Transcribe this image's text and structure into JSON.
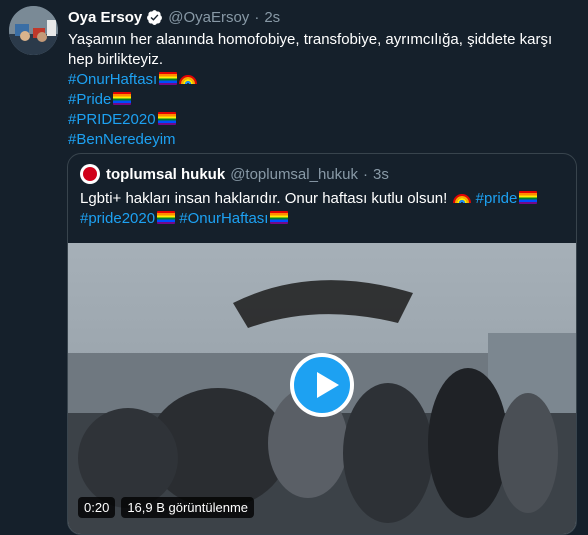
{
  "tweet": {
    "name": "Oya Ersoy",
    "handle": "@OyaErsoy",
    "separator": "·",
    "time": "2s",
    "text": "Yaşamın her alanında homofobiye, transfobiye, ayrımcılığa, şiddete karşı hep birlikteyiz.",
    "hashtags": [
      "#OnurHaftası",
      "#Pride",
      "#PRIDE2020",
      "#BenNeredeyim"
    ]
  },
  "quote": {
    "name": "toplumsal hukuk",
    "handle": "@toplumsal_hukuk",
    "separator": "·",
    "time": "3s",
    "text": "Lgbti+ hakları insan haklarıdır. Onur haftası kutlu olsun!",
    "hashtag_pride": "#pride",
    "hashtag_pride2020": "#pride2020",
    "hashtag_onur": "#OnurHaftası"
  },
  "video": {
    "duration": "0:20",
    "views": "16,9 B görüntülenme"
  },
  "colors": {
    "background": "#15202b",
    "accent": "#1da1f2",
    "muted": "#8899a6",
    "border": "#38444d"
  }
}
